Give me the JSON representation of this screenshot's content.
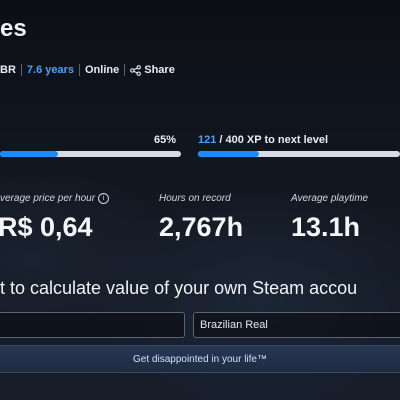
{
  "header": {
    "title": "es"
  },
  "meta": {
    "country": "BR",
    "years": "7.6 years",
    "status": "Online",
    "share_label": "Share"
  },
  "progress": {
    "completion_percent_label": "65%",
    "completion_fraction": 0.32,
    "xp_current": "121",
    "xp_rest": " / 400 XP to next level",
    "xp_fraction": 0.3025
  },
  "stats": [
    {
      "label": "verage price per hour",
      "value": "R$ 0,64",
      "info_icon": "info-icon"
    },
    {
      "label": "Hours on record",
      "value": "2,767h"
    },
    {
      "label": "Average playtime",
      "value": "13.1h"
    }
  ],
  "cta": {
    "text": "t to calculate value of your own Steam accou"
  },
  "form": {
    "account_value": "",
    "currency_value": "Brazilian Real",
    "submit_label": "Get disappointed in your life™"
  },
  "colors": {
    "accent": "#4aa3ff",
    "bar_fill": "#1a8cff",
    "bar_track": "#d7dce3",
    "background": "#0f1219"
  }
}
